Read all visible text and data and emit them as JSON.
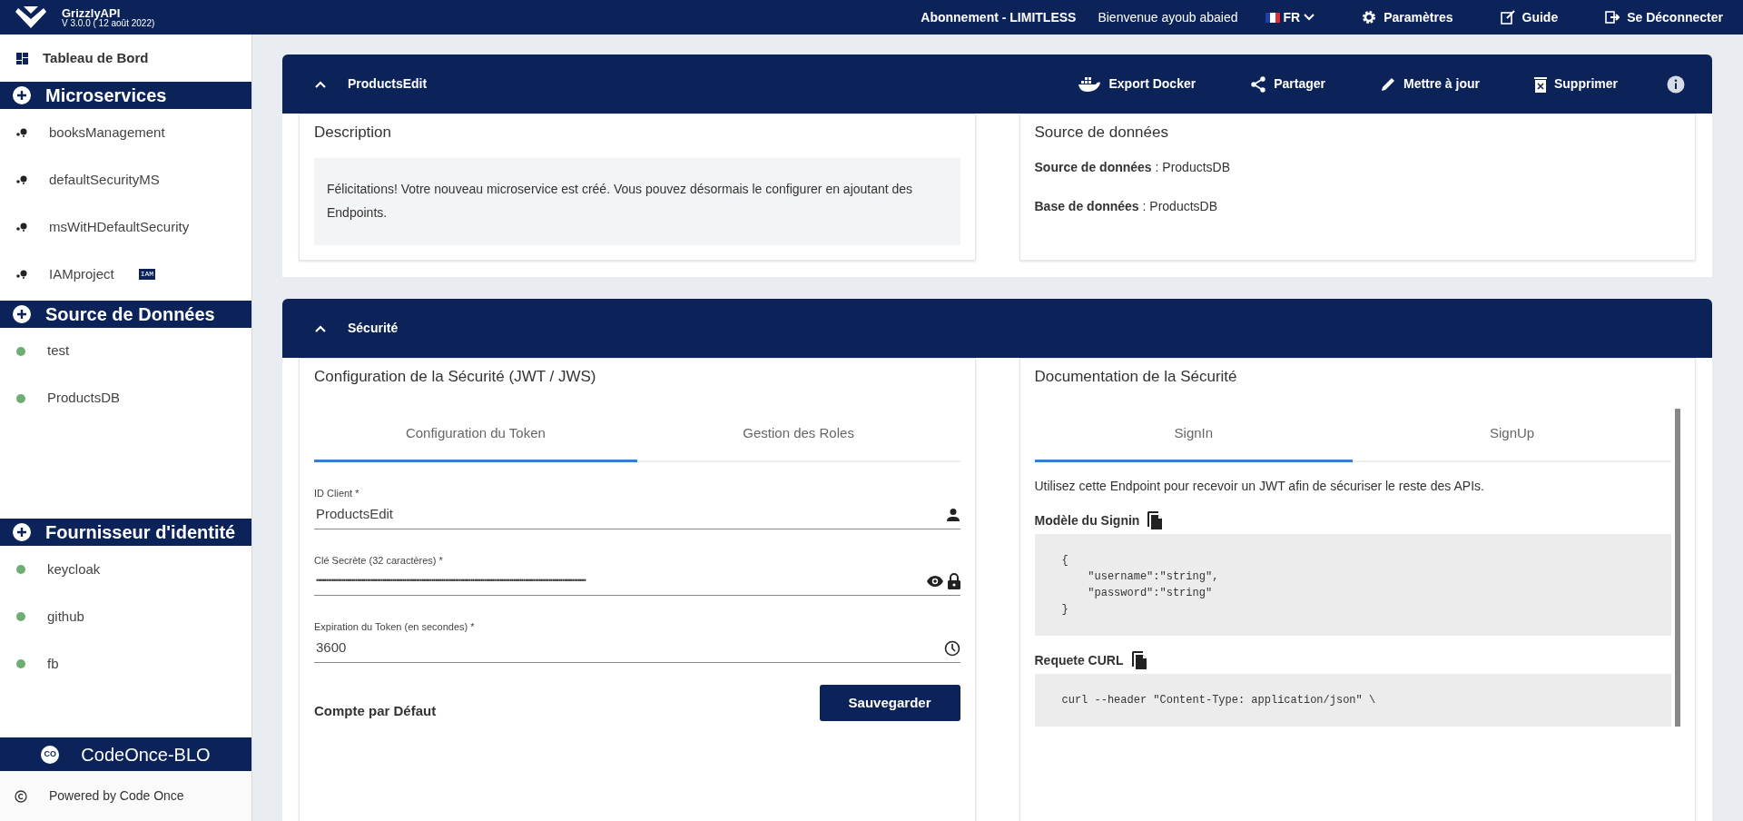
{
  "top_bar": {
    "app_name": "GrizzlyAPI",
    "version": "V 3.0.0 ( 12 août 2022)",
    "subscription": "Abonnement - LIMITLESS",
    "welcome": "Bienvenue ayoub abaied",
    "language": "FR",
    "actions": [
      {
        "kind": "settings",
        "label": "Paramètres"
      },
      {
        "kind": "guide",
        "label": "Guide"
      },
      {
        "kind": "logout",
        "label": "Se Déconnecter"
      }
    ]
  },
  "sidebar": {
    "dashboard": "Tableau de Bord",
    "sections": [
      {
        "title": "Microservices",
        "items": [
          {
            "kind": "service",
            "label": "booksManagement"
          },
          {
            "kind": "service",
            "label": "defaultSecurityMS"
          },
          {
            "kind": "service",
            "label": "msWitHDefaultSecurity"
          },
          {
            "kind": "service",
            "label": "IAMproject",
            "badge": "IAM"
          }
        ]
      },
      {
        "title": "Source de Données",
        "items": [
          {
            "kind": "dot",
            "label": "test",
            "color": "#6dae74"
          },
          {
            "kind": "dot",
            "label": "ProductsDB",
            "color": "#6dae74"
          }
        ]
      },
      {
        "title": "Fournisseur d'identité",
        "items": [
          {
            "kind": "dot",
            "label": "keycloak",
            "color": "#6dae74"
          },
          {
            "kind": "dot",
            "label": "github",
            "color": "#6dae74"
          },
          {
            "kind": "dot",
            "label": "fb",
            "color": "#6dae74"
          }
        ]
      }
    ],
    "brand": "CodeOnce-BLO",
    "brand_badge": "CO",
    "powered_by": "Powered by Code Once"
  },
  "microservice_panel": {
    "title": "ProductsEdit",
    "actions": [
      {
        "kind": "docker",
        "label": "Export Docker"
      },
      {
        "kind": "share",
        "label": "Partager"
      },
      {
        "kind": "edit",
        "label": "Mettre à jour"
      },
      {
        "kind": "delete",
        "label": "Supprimer"
      }
    ],
    "description": {
      "heading": "Description",
      "text": "Félicitations! Votre nouveau microservice est créé. Vous pouvez désormais le configurer en ajoutant des Endpoints."
    },
    "data_source": {
      "heading": "Source de données",
      "lines": [
        "**Source de données** : ProductsDB",
        "**Base de données** : ProductsDB"
      ]
    }
  },
  "security_panel": {
    "title": "Sécurité",
    "config": {
      "heading": "Configuration de la Sécurité (JWT / JWS)",
      "tabs": [
        {
          "label": "Configuration du Token",
          "selected": true
        },
        {
          "label": "Gestion des Roles",
          "selected": false
        }
      ],
      "fields": [
        {
          "kind": "user",
          "label": "ID Client *",
          "value": "ProductsEdit"
        },
        {
          "kind": "secret",
          "label": "Clé Secrète (32 caractères) *",
          "value": "••••••••••••••••••••••••••••••••••••••••••••••••••••••••••••••••••••••••••••••••••••••••••••••••••••••••••••••••••••••••••••••••••••••••••"
        },
        {
          "kind": "time",
          "label": "Expiration du Token (en secondes) *",
          "value": "3600"
        }
      ],
      "save_button": "Sauvegarder",
      "subheading": "Compte par Défaut"
    },
    "docs": {
      "heading": "Documentation de la Sécurité",
      "tabs": [
        {
          "label": "SignIn",
          "selected": true
        },
        {
          "label": "SignUp",
          "selected": false
        }
      ],
      "intro": "Utilisez cette Endpoint pour recevoir un JWT afin de sécuriser le reste des APIs.",
      "sections": [
        {
          "heading": "Modèle du Signin",
          "code": "{\n    \"username\":\"string\",\n    \"password\":\"string\"\n}"
        },
        {
          "heading": "Requete CURL",
          "code": "curl --header \"Content-Type: application/json\" \\"
        }
      ]
    }
  }
}
